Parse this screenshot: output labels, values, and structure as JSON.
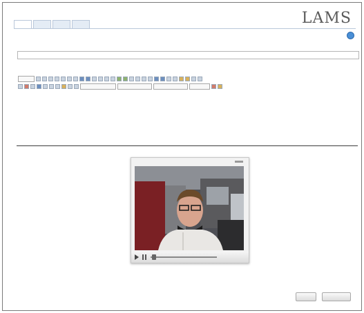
{
  "window_title": "",
  "brand": "LAMS",
  "tabs": [
    {
      "label": ""
    },
    {
      "label": ""
    },
    {
      "label": ""
    },
    {
      "label": ""
    }
  ],
  "title_field": {
    "label": "",
    "value": ""
  },
  "instructions_label": "",
  "editor_text": "",
  "video": {
    "time_display": ""
  },
  "description": "",
  "buttons": {
    "save_label": "",
    "cancel_label": ""
  }
}
